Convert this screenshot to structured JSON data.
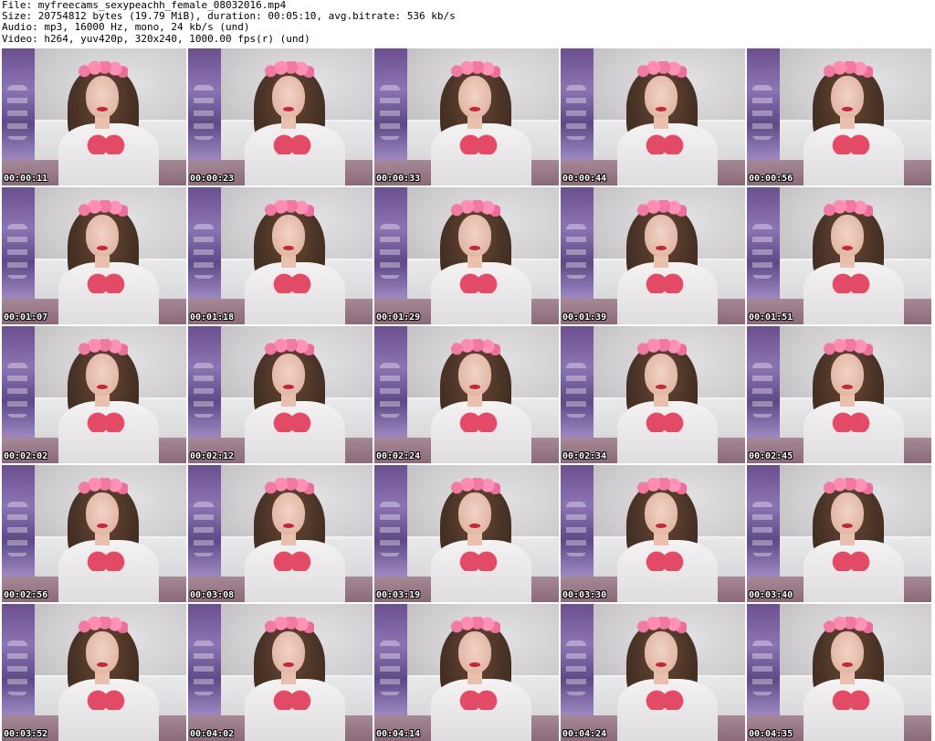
{
  "header": {
    "file": "File: myfreecams_sexypeachh_female_08032016.mp4",
    "size": "Size: 20754812 bytes (19.79 MiB), duration: 00:05:10, avg.bitrate: 536 kb/s",
    "audio": "Audio: mp3, 16000 Hz, mono, 24 kb/s (und)",
    "video": "Video: h264, yuv420p, 320x240, 1000.00 fps(r) (und)"
  },
  "thumbnails": [
    {
      "timestamp": "00:00:11"
    },
    {
      "timestamp": "00:00:23"
    },
    {
      "timestamp": "00:00:33"
    },
    {
      "timestamp": "00:00:44"
    },
    {
      "timestamp": "00:00:56"
    },
    {
      "timestamp": "00:01:07"
    },
    {
      "timestamp": "00:01:18"
    },
    {
      "timestamp": "00:01:29"
    },
    {
      "timestamp": "00:01:39"
    },
    {
      "timestamp": "00:01:51"
    },
    {
      "timestamp": "00:02:02"
    },
    {
      "timestamp": "00:02:12"
    },
    {
      "timestamp": "00:02:24"
    },
    {
      "timestamp": "00:02:34"
    },
    {
      "timestamp": "00:02:45"
    },
    {
      "timestamp": "00:02:56"
    },
    {
      "timestamp": "00:03:08"
    },
    {
      "timestamp": "00:03:19"
    },
    {
      "timestamp": "00:03:30"
    },
    {
      "timestamp": "00:03:40"
    },
    {
      "timestamp": "00:03:52"
    },
    {
      "timestamp": "00:04:02"
    },
    {
      "timestamp": "00:04:14"
    },
    {
      "timestamp": "00:04:24"
    },
    {
      "timestamp": "00:04:35"
    }
  ]
}
